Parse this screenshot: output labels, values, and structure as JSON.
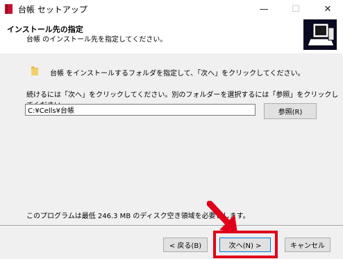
{
  "window": {
    "title": "台帳 セットアップ",
    "minimize_glyph": "—",
    "maximize_glyph": "☐",
    "close_glyph": "✕"
  },
  "header": {
    "title": "インストール先の指定",
    "subtitle": "台帳 のインストール先を指定してください。"
  },
  "body": {
    "intro": "台帳 をインストールするフォルダを指定して、「次へ」をクリックしてください。",
    "continue_text": "続けるには「次へ」をクリックしてください。別のフォルダーを選択するには「参照」をクリックしてください。",
    "path_value": "C:¥Cells¥台帳",
    "browse_label": "参照(R)",
    "space_required": "このプログラムは最低 246.3 MB のディスク空き領域を必要とします。"
  },
  "footer": {
    "back_label": "< 戻る(B)",
    "next_label": "次へ(N) >",
    "cancel_label": "キャンセル"
  },
  "colors": {
    "highlight": "#e0001a",
    "accent": "#0078d7"
  }
}
